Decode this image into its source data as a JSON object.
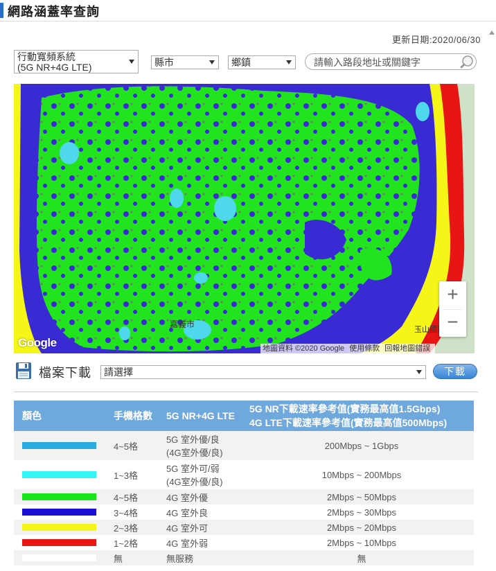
{
  "page": {
    "title": "網路涵蓋率查詢",
    "update_date": "更新日期:2020/06/30"
  },
  "filters": {
    "system": {
      "line1": "行動寬頻系統",
      "line2": "(5G NR+4G LTE)"
    },
    "county": "縣市",
    "town": "鄉鎮",
    "search_placeholder": "請輸入路段地址或關鍵字"
  },
  "map": {
    "zoom_in": "+",
    "zoom_out": "−",
    "attribution": {
      "data": "地圖資料 ©2020 Google",
      "terms": "使用條款",
      "report": "回報地圖錯誤"
    },
    "logo": "Google",
    "place_labels": [
      "嘉義市",
      "玉山國家公園"
    ]
  },
  "download": {
    "label": "檔案下載",
    "select_value": "請選擇",
    "button": "下載"
  },
  "legend": {
    "headers": {
      "color": "顏色",
      "bars": "手機格數",
      "system": "5G NR+4G LTE",
      "speed_line1": "5G NR下載速率參考值(實務最高值1.5Gbps)",
      "speed_line2": "4G LTE下載速率參考值(實務最高值500Mbps)"
    },
    "rows": [
      {
        "color": "#29abe2",
        "bars": "4~5格",
        "system": "5G 室外優/良",
        "system2": "(4G室外優/良)",
        "speed": "200Mbps ~ 1Gbps"
      },
      {
        "color": "#33f5f5",
        "bars": "1~3格",
        "system": "5G 室外可/弱",
        "system2": "(4G室外優/良)",
        "speed": "10Mbps ~ 200Mbps"
      },
      {
        "color": "#19e619",
        "bars": "4~5格",
        "system": "4G 室外優",
        "system2": "",
        "speed": "2Mbps ~ 50Mbps"
      },
      {
        "color": "#1a0ed6",
        "bars": "3~4格",
        "system": "4G 室外良",
        "system2": "",
        "speed": "2Mbps ~ 30Mbps"
      },
      {
        "color": "#f5f518",
        "bars": "2~3格",
        "system": "4G 室外可",
        "system2": "",
        "speed": "2Mbps ~ 20Mbps"
      },
      {
        "color": "#e81515",
        "bars": "1~2格",
        "system": "4G 室外弱",
        "system2": "",
        "speed": "2Mbps ~ 10Mbps"
      },
      {
        "color": "#ffffff",
        "bars": "無",
        "system": "無服務",
        "system2": "",
        "speed": "無"
      }
    ]
  }
}
